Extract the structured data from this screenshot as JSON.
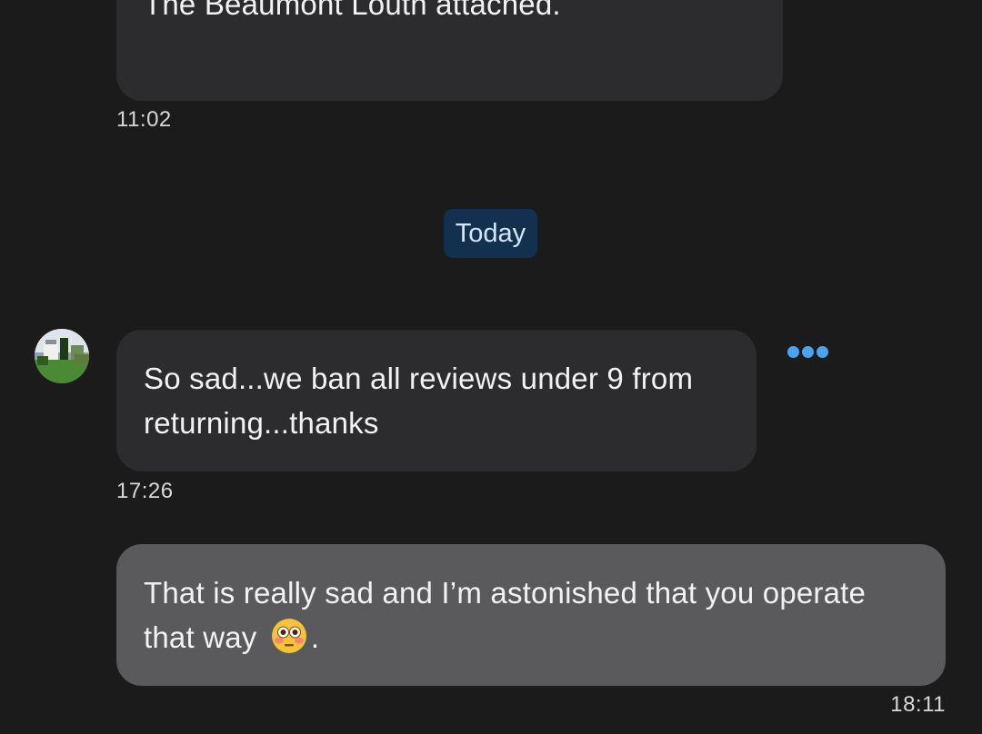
{
  "messages": [
    {
      "text": "The Beaumont Louth attached.",
      "time": "11:02",
      "direction": "incoming"
    },
    {
      "text": "So sad...we ban all reviews under 9 from returning...thanks",
      "time": "17:26",
      "direction": "incoming"
    },
    {
      "text_before_emoji": "That is really sad and I’m astonished that you operate that way",
      "emoji": "flushed-face",
      "text_after_emoji": ".",
      "time": "18:11",
      "direction": "outgoing"
    }
  ],
  "date_separator": "Today",
  "icons": {
    "avatar": "sender-avatar-garden-photo",
    "more": "more-options-icon"
  },
  "colors": {
    "background": "#1b1b1b",
    "incoming_bubble": "#2c2c2e",
    "outgoing_bubble": "#5a5a5c",
    "date_chip": "#13304f",
    "accent": "#4aa3f0"
  }
}
